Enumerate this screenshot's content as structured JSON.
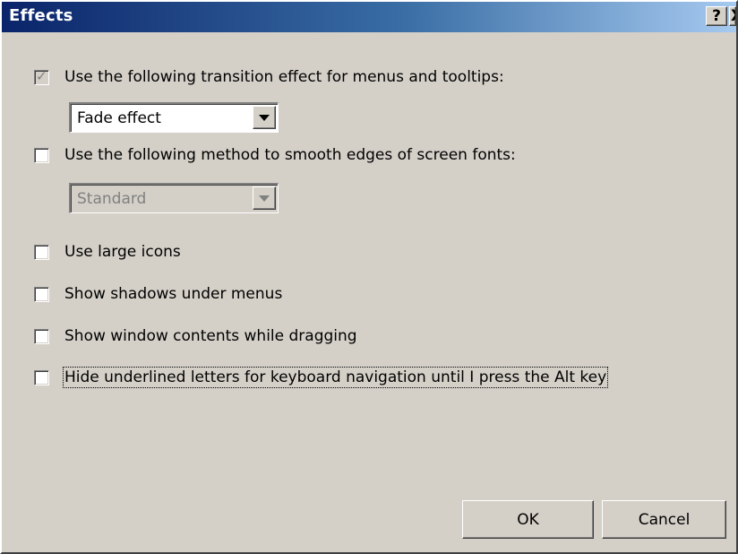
{
  "window": {
    "title": "Effects",
    "help_glyph": "?",
    "close_glyph": "X"
  },
  "options": {
    "transition": {
      "label": "Use the following transition effect for menus and tooltips:",
      "checked": true,
      "disabled": true,
      "select_value": "Fade effect"
    },
    "smooth_fonts": {
      "label": "Use the following method to smooth edges of screen fonts:",
      "checked": false,
      "select_value": "Standard",
      "select_disabled": true
    },
    "large_icons": {
      "label": "Use large icons",
      "checked": false
    },
    "menu_shadows": {
      "label": "Show shadows under menus",
      "checked": false
    },
    "drag_contents": {
      "label": "Show window contents while dragging",
      "checked": false
    },
    "hide_underlines": {
      "label": "Hide underlined letters for keyboard navigation until I press the Alt key",
      "checked": false
    }
  },
  "buttons": {
    "ok": "OK",
    "cancel": "Cancel"
  },
  "colors": {
    "face": "#d4d0c8",
    "title_start": "#0a246a",
    "title_end": "#a6caf0"
  }
}
